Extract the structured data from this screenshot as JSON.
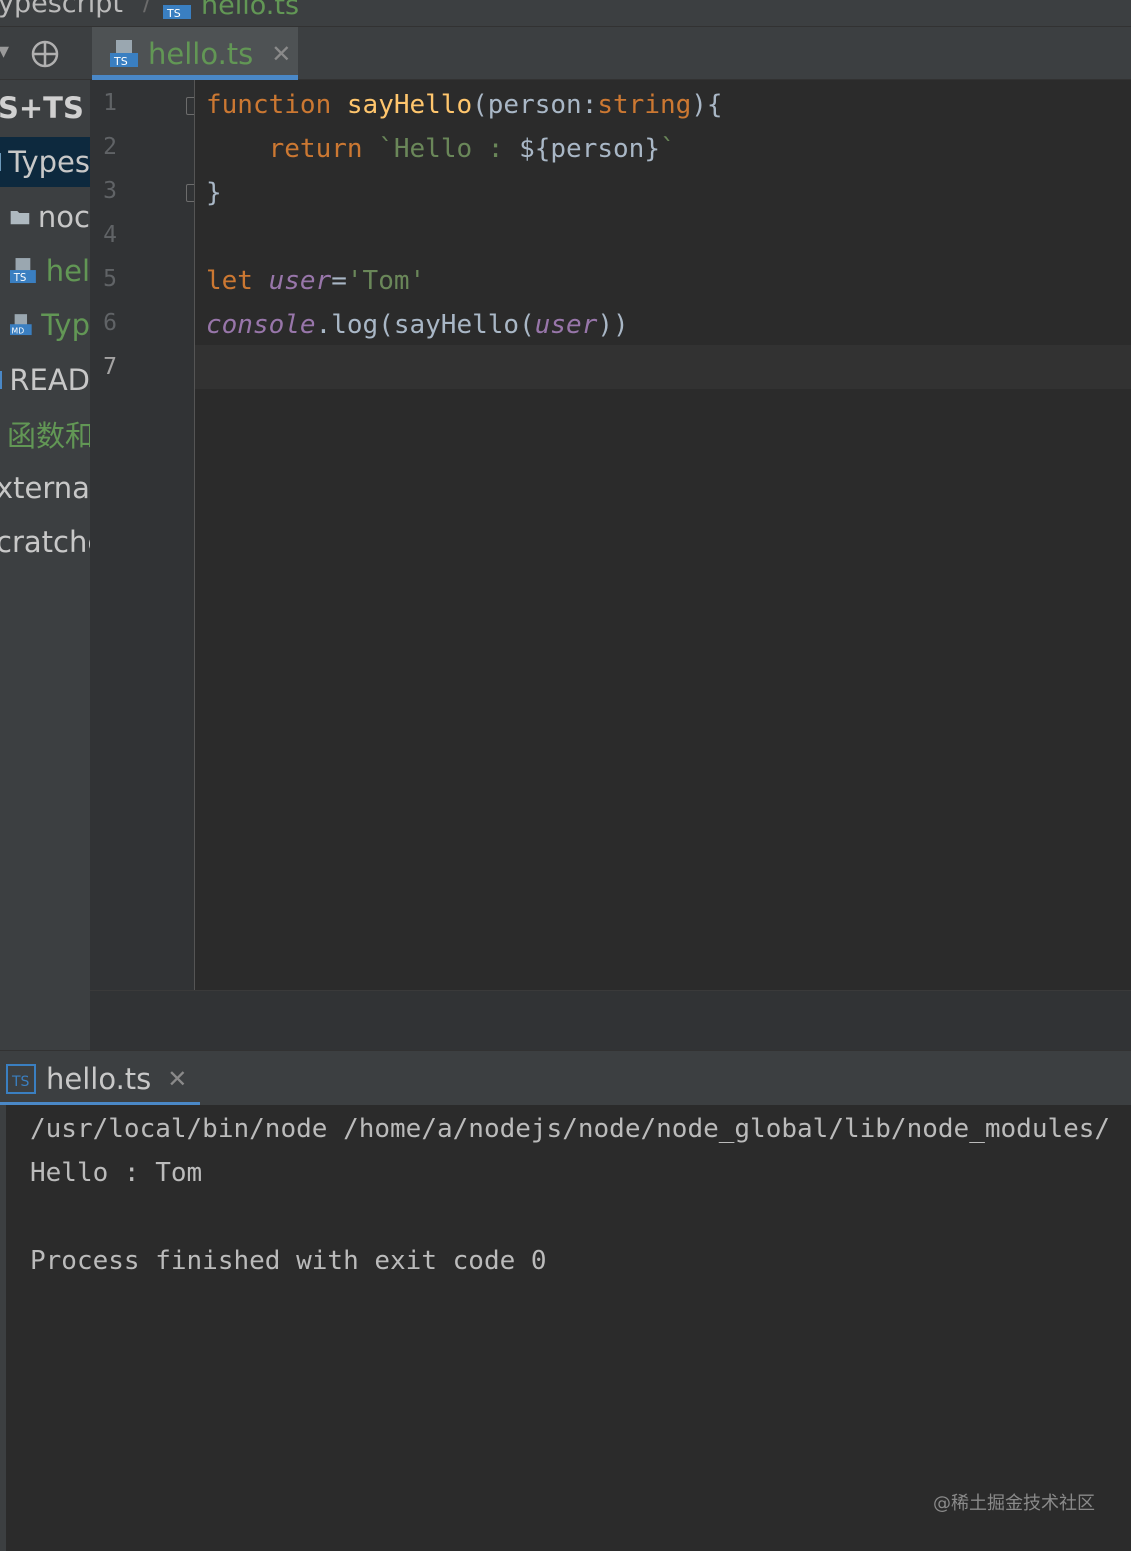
{
  "breadcrumb": {
    "project": "ypescript",
    "separator": "/",
    "file": "hello.ts"
  },
  "project_panel": {
    "items": [
      {
        "label": "S+TS",
        "kind": "root"
      },
      {
        "label": "Types",
        "kind": "module",
        "selected": true
      },
      {
        "label": "noc",
        "kind": "folder"
      },
      {
        "label": "hel",
        "kind": "ts-file"
      },
      {
        "label": "Typ",
        "kind": "md-file"
      },
      {
        "label": "READ",
        "kind": "text"
      },
      {
        "label": "函数和",
        "kind": "text"
      },
      {
        "label": "xternal",
        "kind": "text"
      },
      {
        "label": "cratche",
        "kind": "text"
      }
    ]
  },
  "editor": {
    "tab_label": "hello.ts",
    "file_icon_badge": "TS",
    "md_icon_badge": "MD",
    "line_numbers": [
      "1",
      "2",
      "3",
      "4",
      "5",
      "6",
      "7"
    ],
    "code": {
      "l1": {
        "kw": "function",
        "name": "sayHello",
        "open": "(person:",
        "type": "string",
        "close": "){"
      },
      "l2": {
        "kw": "return",
        "bq_open": "`Hello : ",
        "expr": "${person}",
        "bq_close": "`"
      },
      "l3": {
        "text": "}"
      },
      "l5": {
        "kw": "let",
        "var": "user",
        "eq": "=",
        "str": "'Tom'"
      },
      "l6": {
        "obj": "console",
        "call": ".log(sayHello(",
        "arg": "user",
        "close": "))"
      }
    }
  },
  "run": {
    "tab_label": "hello.ts",
    "output": [
      "/usr/local/bin/node /home/a/nodejs/node/node_global/lib/node_modules/",
      "Hello : Tom",
      "",
      "Process finished with exit code 0"
    ]
  },
  "watermark": "@稀土掘金技术社区",
  "colors": {
    "keyword": "#cc7832",
    "function": "#ffc66d",
    "string": "#6a8759",
    "variable": "#9876aa",
    "accent": "#4a88c7"
  }
}
